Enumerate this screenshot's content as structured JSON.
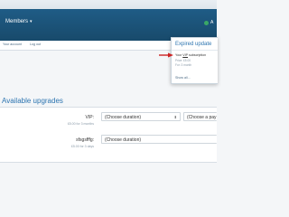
{
  "nav": {
    "members_label": "Members",
    "user_label": "A"
  },
  "subnav": {
    "your_account": "Your account",
    "log_out": "Log out"
  },
  "upgrades": {
    "section_title": "Available upgrades",
    "rows": [
      {
        "name": "VIP:",
        "sub": "£5.00 for 3 months",
        "duration_placeholder": "(Choose duration)",
        "payment_placeholder": "(Choose a pay"
      },
      {
        "name": "sfsgsfffg:",
        "sub": "£5.00 for 3 days",
        "duration_placeholder": "(Choose duration)"
      }
    ]
  },
  "popup": {
    "title": "Expired update",
    "message_prefix": "Your",
    "message_highlight": "VIP",
    "message_suffix": "subscription",
    "meta_1": "Price: £5.00",
    "meta_2": "For: 3 month",
    "show_all": "Show all..."
  },
  "colors": {
    "navbar": "#1f5c86",
    "accent": "#2c74b0",
    "arrow": "#cc2222"
  }
}
